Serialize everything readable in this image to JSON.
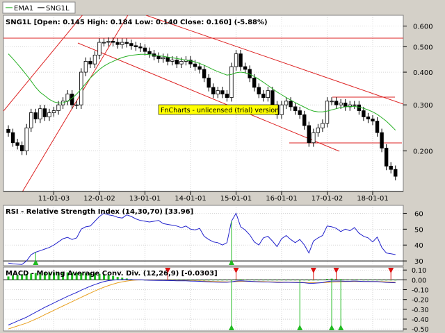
{
  "legend": {
    "items": [
      {
        "label": "EMA1",
        "color": "#27b024"
      },
      {
        "label": "SNG1L",
        "color": "#000000"
      }
    ]
  },
  "colors": {
    "ema": "#27b024",
    "rsi": "#2222cc",
    "macd": "#2222cc",
    "signal": "#e8a020",
    "trend": "#dd2222",
    "buy": "#22bb22",
    "sell": "#dd1111",
    "bg": "#ffffff",
    "frame": "#d4d0c8"
  },
  "watermark": "FnCharts - unlicensed (trial) version",
  "chart_data": [
    {
      "type": "candlestick",
      "title": "SNG1L [Open: 0.145  High: 0.184  Low: 0.140  Close: 0.160] (-5.88%)",
      "scale": "log",
      "ylim": [
        0.14,
        0.66
      ],
      "yticks": [
        "0.600",
        "0.500",
        "0.400",
        "0.300",
        "0.200"
      ],
      "ytick_values": [
        0.6,
        0.5,
        0.4,
        0.3,
        0.2
      ],
      "xticks": [
        {
          "label": "11-01-03",
          "index": 10
        },
        {
          "label": "12-01-02",
          "index": 20
        },
        {
          "label": "13-01-01",
          "index": 30
        },
        {
          "label": "14-01-01",
          "index": 40
        },
        {
          "label": "15-01-01",
          "index": 50
        },
        {
          "label": "16-01-01",
          "index": 60
        },
        {
          "label": "17-01-02",
          "index": 70
        },
        {
          "label": "18-01-01",
          "index": 80
        }
      ],
      "count": 86,
      "close": [
        0.235,
        0.215,
        0.21,
        0.2,
        0.245,
        0.28,
        0.265,
        0.29,
        0.27,
        0.28,
        0.285,
        0.3,
        0.31,
        0.33,
        0.3,
        0.3,
        0.4,
        0.44,
        0.43,
        0.465,
        0.52,
        0.52,
        0.525,
        0.52,
        0.51,
        0.52,
        0.515,
        0.505,
        0.5,
        0.495,
        0.48,
        0.47,
        0.46,
        0.45,
        0.455,
        0.44,
        0.445,
        0.43,
        0.44,
        0.445,
        0.43,
        0.42,
        0.41,
        0.38,
        0.35,
        0.33,
        0.34,
        0.33,
        0.32,
        0.42,
        0.47,
        0.42,
        0.41,
        0.38,
        0.35,
        0.33,
        0.32,
        0.34,
        0.3,
        0.275,
        0.3,
        0.31,
        0.295,
        0.285,
        0.275,
        0.25,
        0.215,
        0.235,
        0.245,
        0.255,
        0.31,
        0.31,
        0.3,
        0.305,
        0.295,
        0.3,
        0.3,
        0.285,
        0.27,
        0.265,
        0.26,
        0.235,
        0.205,
        0.175,
        0.17,
        0.16
      ],
      "ema": [
        0.47,
        0.45,
        0.43,
        0.41,
        0.39,
        0.37,
        0.35,
        0.335,
        0.325,
        0.315,
        0.308,
        0.305,
        0.305,
        0.31,
        0.318,
        0.33,
        0.345,
        0.362,
        0.38,
        0.395,
        0.41,
        0.422,
        0.432,
        0.44,
        0.448,
        0.455,
        0.46,
        0.464,
        0.466,
        0.468,
        0.468,
        0.467,
        0.465,
        0.462,
        0.46,
        0.457,
        0.454,
        0.451,
        0.448,
        0.445,
        0.442,
        0.438,
        0.432,
        0.425,
        0.417,
        0.409,
        0.402,
        0.396,
        0.39,
        0.392,
        0.398,
        0.4,
        0.398,
        0.393,
        0.385,
        0.376,
        0.366,
        0.356,
        0.346,
        0.336,
        0.328,
        0.32,
        0.313,
        0.306,
        0.3,
        0.294,
        0.288,
        0.284,
        0.282,
        0.282,
        0.284,
        0.287,
        0.29,
        0.293,
        0.295,
        0.296,
        0.296,
        0.294,
        0.291,
        0.287,
        0.282,
        0.276,
        0.268,
        0.26,
        0.25,
        0.24
      ]
    },
    {
      "type": "line",
      "title": "RSI - Relative Strength Index (14,30,70) [33.96]",
      "ylim": [
        27,
        65
      ],
      "yticks": [
        "60",
        "50",
        "40",
        "30"
      ],
      "ytick_values": [
        60,
        50,
        40,
        30
      ],
      "levels": [
        30,
        70
      ],
      "count": 86,
      "values": [
        28.6,
        28.2,
        28.0,
        27.8,
        30.0,
        34.0,
        35.5,
        36.5,
        37.5,
        38.5,
        40.0,
        42.0,
        44.0,
        44.8,
        43.5,
        44.5,
        50.0,
        51.5,
        52.0,
        55.0,
        58.0,
        60.0,
        59.0,
        58.5,
        57.5,
        57.0,
        59.0,
        58.0,
        56.5,
        55.5,
        55.0,
        54.5,
        55.0,
        55.5,
        53.5,
        53.0,
        52.5,
        52.0,
        51.0,
        52.0,
        50.0,
        49.5,
        50.5,
        45.5,
        43.5,
        42.0,
        41.5,
        40.0,
        41.5,
        55.0,
        60.0,
        51.5,
        49.5,
        46.5,
        42.0,
        40.0,
        44.5,
        45.5,
        42.5,
        39.0,
        44.0,
        46.0,
        43.5,
        41.5,
        43.5,
        40.0,
        35.0,
        42.5,
        44.5,
        46.0,
        52.0,
        51.5,
        50.5,
        48.5,
        50.0,
        49.0,
        51.0,
        47.5,
        45.5,
        44.5,
        42.0,
        45.0,
        38.5,
        35.0,
        34.5,
        34.0
      ],
      "signals": [
        {
          "index": 6,
          "kind": "buy"
        },
        {
          "index": 49,
          "kind": "buy"
        }
      ]
    },
    {
      "type": "line",
      "title": "MACD - Moving Average Conv. Div. (12,26,9) [-0.0303]",
      "ylim": [
        -0.52,
        0.13
      ],
      "yticks": [
        "0.10",
        "0.00",
        "-0.10",
        "-0.20",
        "-0.30",
        "-0.40",
        "-0.50"
      ],
      "ytick_values": [
        0.1,
        0.0,
        -0.1,
        -0.2,
        -0.3,
        -0.4,
        -0.5
      ],
      "count": 86,
      "macd": [
        -0.46,
        -0.44,
        -0.42,
        -0.4,
        -0.38,
        -0.355,
        -0.33,
        -0.305,
        -0.28,
        -0.258,
        -0.235,
        -0.212,
        -0.19,
        -0.168,
        -0.148,
        -0.128,
        -0.105,
        -0.085,
        -0.065,
        -0.048,
        -0.032,
        -0.018,
        -0.008,
        -0.003,
        0.0,
        0.002,
        0.002,
        0.002,
        0.0,
        0.0,
        -0.002,
        -0.004,
        -0.005,
        -0.006,
        -0.006,
        -0.007,
        -0.008,
        -0.009,
        -0.01,
        -0.01,
        -0.012,
        -0.013,
        -0.015,
        -0.018,
        -0.02,
        -0.022,
        -0.024,
        -0.025,
        -0.025,
        -0.02,
        -0.012,
        -0.01,
        -0.012,
        -0.015,
        -0.018,
        -0.02,
        -0.022,
        -0.022,
        -0.024,
        -0.026,
        -0.026,
        -0.025,
        -0.026,
        -0.027,
        -0.028,
        -0.03,
        -0.035,
        -0.035,
        -0.032,
        -0.028,
        -0.018,
        -0.012,
        -0.012,
        -0.012,
        -0.014,
        -0.014,
        -0.012,
        -0.014,
        -0.016,
        -0.016,
        -0.018,
        -0.018,
        -0.022,
        -0.026,
        -0.028,
        -0.03
      ],
      "signal": [
        -0.5,
        -0.485,
        -0.47,
        -0.455,
        -0.44,
        -0.42,
        -0.4,
        -0.378,
        -0.355,
        -0.333,
        -0.31,
        -0.288,
        -0.266,
        -0.244,
        -0.222,
        -0.2,
        -0.178,
        -0.156,
        -0.134,
        -0.113,
        -0.093,
        -0.075,
        -0.058,
        -0.043,
        -0.03,
        -0.02,
        -0.012,
        -0.006,
        -0.003,
        -0.001,
        -0.001,
        -0.002,
        -0.003,
        -0.004,
        -0.005,
        -0.005,
        -0.006,
        -0.007,
        -0.008,
        -0.008,
        -0.009,
        -0.01,
        -0.011,
        -0.012,
        -0.014,
        -0.016,
        -0.018,
        -0.019,
        -0.02,
        -0.02,
        -0.018,
        -0.016,
        -0.015,
        -0.015,
        -0.016,
        -0.017,
        -0.018,
        -0.019,
        -0.02,
        -0.021,
        -0.022,
        -0.022,
        -0.023,
        -0.024,
        -0.025,
        -0.026,
        -0.028,
        -0.029,
        -0.03,
        -0.029,
        -0.027,
        -0.024,
        -0.021,
        -0.019,
        -0.018,
        -0.017,
        -0.016,
        -0.016,
        -0.016,
        -0.016,
        -0.016,
        -0.017,
        -0.018,
        -0.02,
        -0.022,
        -0.024
      ],
      "histogram": [
        0.035,
        0.045,
        0.05,
        0.055,
        0.06,
        0.065,
        0.07,
        0.073,
        0.075,
        0.075,
        0.075,
        0.076,
        0.076,
        0.076,
        0.074,
        0.072,
        0.073,
        0.071,
        0.069,
        0.065,
        0.061,
        0.057,
        0.05,
        0.04,
        0.03,
        0.022,
        0.014,
        0.008,
        0.003,
        0.001,
        -0.001,
        -0.002,
        -0.002,
        -0.002,
        -0.001,
        -0.002,
        -0.002,
        -0.002,
        -0.002,
        -0.002,
        -0.003,
        -0.003,
        -0.004,
        -0.006,
        -0.006,
        -0.006,
        -0.006,
        -0.006,
        -0.005,
        0.0,
        0.006,
        0.006,
        0.003,
        0.0,
        -0.002,
        -0.003,
        -0.004,
        -0.003,
        -0.004,
        -0.005,
        -0.004,
        -0.003,
        -0.003,
        -0.003,
        -0.003,
        -0.004,
        -0.007,
        -0.006,
        -0.002,
        0.001,
        0.009,
        0.012,
        0.009,
        0.007,
        0.004,
        0.003,
        0.004,
        0.002,
        0.0,
        0.0,
        -0.002,
        -0.001,
        -0.004,
        -0.006,
        -0.006,
        -0.006
      ],
      "signals": [
        {
          "index": 35,
          "kind": "sell"
        },
        {
          "index": 49,
          "kind": "buy"
        },
        {
          "index": 50,
          "kind": "sell"
        },
        {
          "index": 64,
          "kind": "buy"
        },
        {
          "index": 67,
          "kind": "sell"
        },
        {
          "index": 71,
          "kind": "buy"
        },
        {
          "index": 72,
          "kind": "sell"
        },
        {
          "index": 73,
          "kind": "buy"
        },
        {
          "index": 84,
          "kind": "sell"
        }
      ]
    }
  ]
}
